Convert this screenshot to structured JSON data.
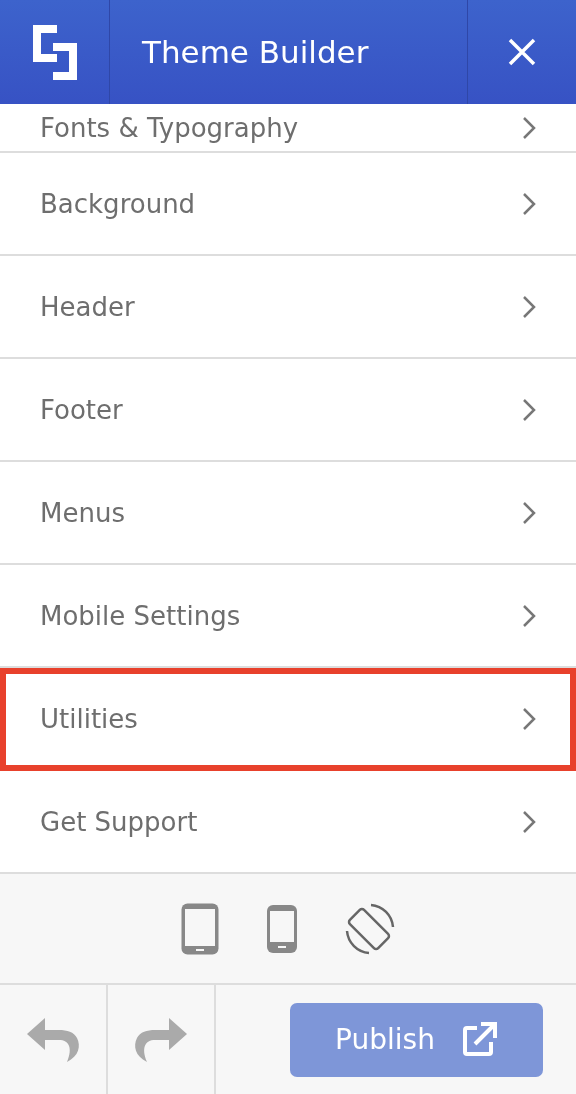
{
  "header": {
    "title": "Theme Builder"
  },
  "menu_items": [
    {
      "label": "Fonts & Typography",
      "highlighted": false
    },
    {
      "label": "Background",
      "highlighted": false
    },
    {
      "label": "Header",
      "highlighted": false
    },
    {
      "label": "Footer",
      "highlighted": false
    },
    {
      "label": "Menus",
      "highlighted": false
    },
    {
      "label": "Mobile Settings",
      "highlighted": false
    },
    {
      "label": "Utilities",
      "highlighted": true
    },
    {
      "label": "Get Support",
      "highlighted": false
    }
  ],
  "footer": {
    "publish_label": "Publish"
  }
}
